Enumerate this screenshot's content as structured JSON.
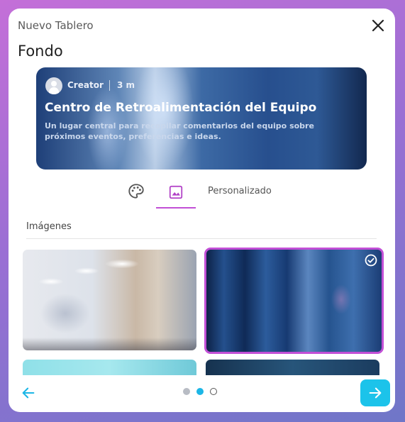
{
  "modal": {
    "title": "Nuevo Tablero",
    "section_heading": "Fondo"
  },
  "preview": {
    "author": "Creator",
    "time": "3 m",
    "board_title": "Centro de Retroalimentación del Equipo",
    "board_description": "Un lugar central para recopilar comentarios del equipo sobre próximos eventos, preferencias e ideas."
  },
  "tabs": {
    "palette_icon": "palette-icon",
    "image_icon": "image-icon",
    "custom_label": "Personalizado",
    "active": "image"
  },
  "gallery": {
    "label": "Imágenes",
    "selected_index": 1,
    "images": [
      {
        "name": "office-blur"
      },
      {
        "name": "blue-blur"
      },
      {
        "name": "aqua-leaves"
      },
      {
        "name": "night-sky"
      }
    ]
  },
  "footer": {
    "back_icon": "arrow-left-icon",
    "next_icon": "arrow-right-icon",
    "total_steps": 3,
    "current_step": 2
  },
  "colors": {
    "accent_purple": "#c24fd6",
    "accent_cyan": "#1cc3ea"
  }
}
